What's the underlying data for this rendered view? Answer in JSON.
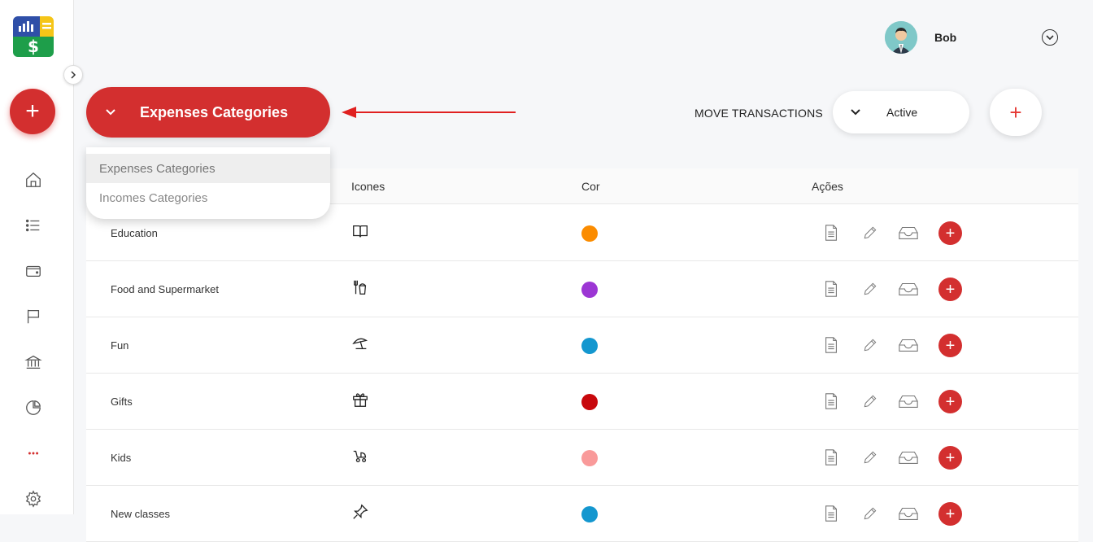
{
  "user": {
    "name": "Bob"
  },
  "category_select": {
    "selected": "Expenses Categories",
    "options": [
      "Expenses Categories",
      "Incomes Categories"
    ]
  },
  "toolbar": {
    "move_transactions": "MOVE TRANSACTIONS",
    "status": "Active",
    "add_label": "+"
  },
  "fab_label": "+",
  "sidebar": {
    "items": [
      "home-icon",
      "list-icon",
      "wallet-icon",
      "flag-icon",
      "bank-icon",
      "pie-chart-icon",
      "more-icon",
      "settings-icon"
    ]
  },
  "table": {
    "headers": {
      "icons": "Icones",
      "color": "Cor",
      "actions": "Ações"
    },
    "rows": [
      {
        "name": "Education",
        "icon": "book-icon",
        "color": "#fb8c00"
      },
      {
        "name": "Food and Supermarket",
        "icon": "fork-cup-icon",
        "color": "#9c36d4"
      },
      {
        "name": "Fun",
        "icon": "beach-umbrella-icon",
        "color": "#1497cf"
      },
      {
        "name": "Gifts",
        "icon": "gift-icon",
        "color": "#c8080c"
      },
      {
        "name": "Kids",
        "icon": "stroller-icon",
        "color": "#f99a9a"
      },
      {
        "name": "New classes",
        "icon": "pin-icon",
        "color": "#1497cf"
      }
    ]
  },
  "colors": {
    "accent": "#d32f2f"
  }
}
